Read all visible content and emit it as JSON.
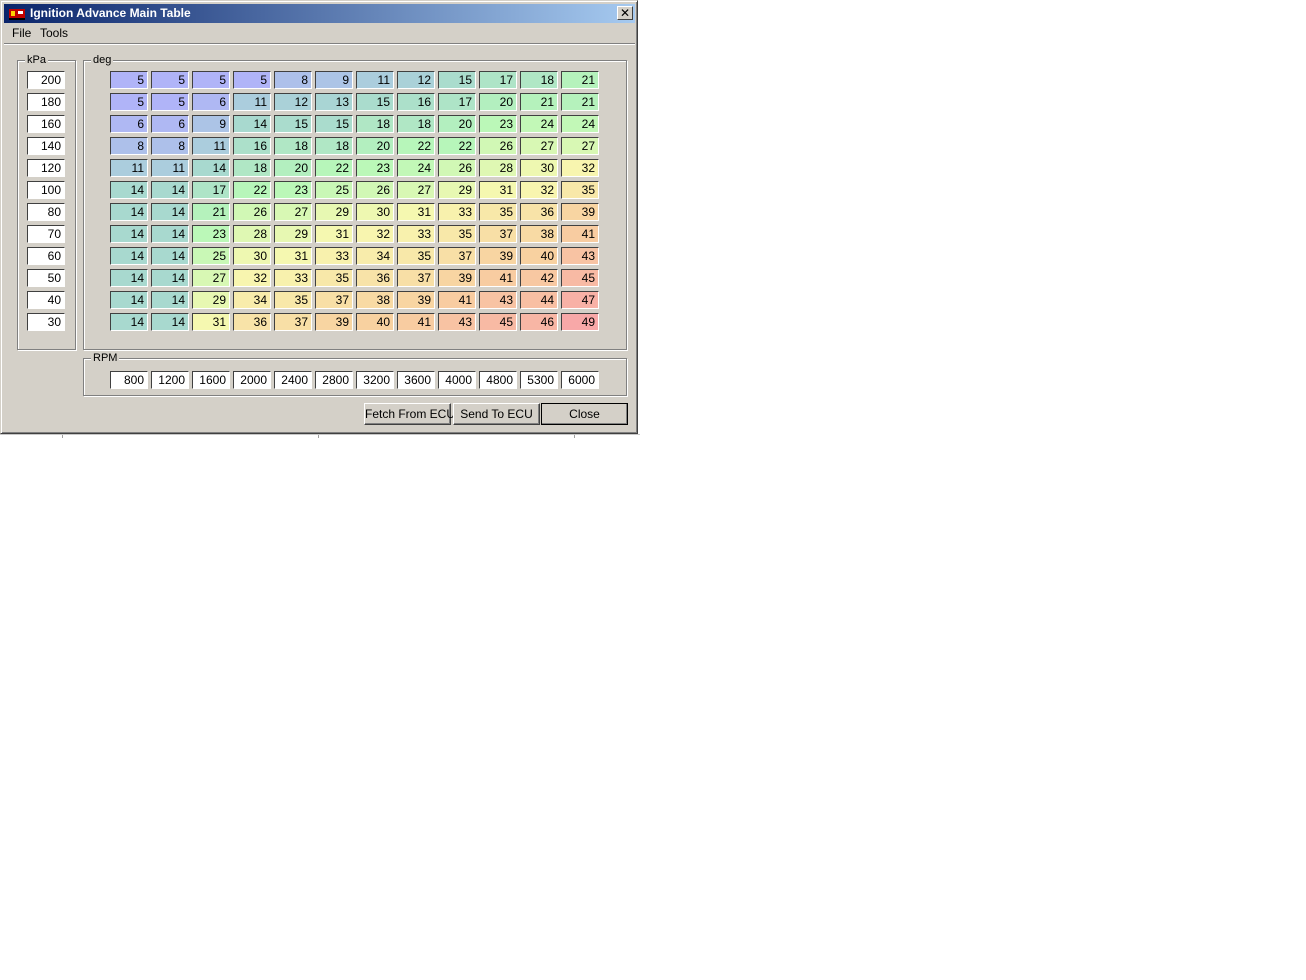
{
  "window": {
    "title": "Ignition Advance Main Table",
    "close_glyph": "✕"
  },
  "menu": {
    "items": [
      "File",
      "Tools"
    ]
  },
  "load_axis": {
    "label": "kPa",
    "values": [
      "200",
      "180",
      "160",
      "140",
      "120",
      "100",
      "80",
      "70",
      "60",
      "50",
      "40",
      "30"
    ]
  },
  "table": {
    "label": "deg",
    "rows": [
      [
        "5",
        "5",
        "5",
        "5",
        "8",
        "9",
        "11",
        "12",
        "15",
        "17",
        "18",
        "21"
      ],
      [
        "5",
        "5",
        "6",
        "11",
        "12",
        "13",
        "15",
        "16",
        "17",
        "20",
        "21",
        "21"
      ],
      [
        "6",
        "6",
        "9",
        "14",
        "15",
        "15",
        "18",
        "18",
        "20",
        "23",
        "24",
        "24"
      ],
      [
        "8",
        "8",
        "11",
        "16",
        "18",
        "18",
        "20",
        "22",
        "22",
        "26",
        "27",
        "27"
      ],
      [
        "11",
        "11",
        "14",
        "18",
        "20",
        "22",
        "23",
        "24",
        "26",
        "28",
        "30",
        "32"
      ],
      [
        "14",
        "14",
        "17",
        "22",
        "23",
        "25",
        "26",
        "27",
        "29",
        "31",
        "32",
        "35"
      ],
      [
        "14",
        "14",
        "21",
        "26",
        "27",
        "29",
        "30",
        "31",
        "33",
        "35",
        "36",
        "39"
      ],
      [
        "14",
        "14",
        "23",
        "28",
        "29",
        "31",
        "32",
        "33",
        "35",
        "37",
        "38",
        "41"
      ],
      [
        "14",
        "14",
        "25",
        "30",
        "31",
        "33",
        "34",
        "35",
        "37",
        "39",
        "40",
        "43"
      ],
      [
        "14",
        "14",
        "27",
        "32",
        "33",
        "35",
        "36",
        "37",
        "39",
        "41",
        "42",
        "45"
      ],
      [
        "14",
        "14",
        "29",
        "34",
        "35",
        "37",
        "38",
        "39",
        "41",
        "43",
        "44",
        "47"
      ],
      [
        "14",
        "14",
        "31",
        "36",
        "37",
        "39",
        "40",
        "41",
        "43",
        "45",
        "46",
        "49"
      ]
    ],
    "color_scale": {
      "min_value": 5,
      "max_value": 49,
      "stops": [
        "#b0b4f8",
        "#a8d8d0",
        "#b8f8b8",
        "#f8f8b0",
        "#f8d0a0",
        "#f8a8a8"
      ]
    }
  },
  "rpm_axis": {
    "label": "RPM",
    "values": [
      "800",
      "1200",
      "1600",
      "2000",
      "2400",
      "2800",
      "3200",
      "3600",
      "4000",
      "4800",
      "5300",
      "6000"
    ]
  },
  "buttons": {
    "fetch": "Fetch From ECU",
    "send": "Send To ECU",
    "close": "Close"
  }
}
